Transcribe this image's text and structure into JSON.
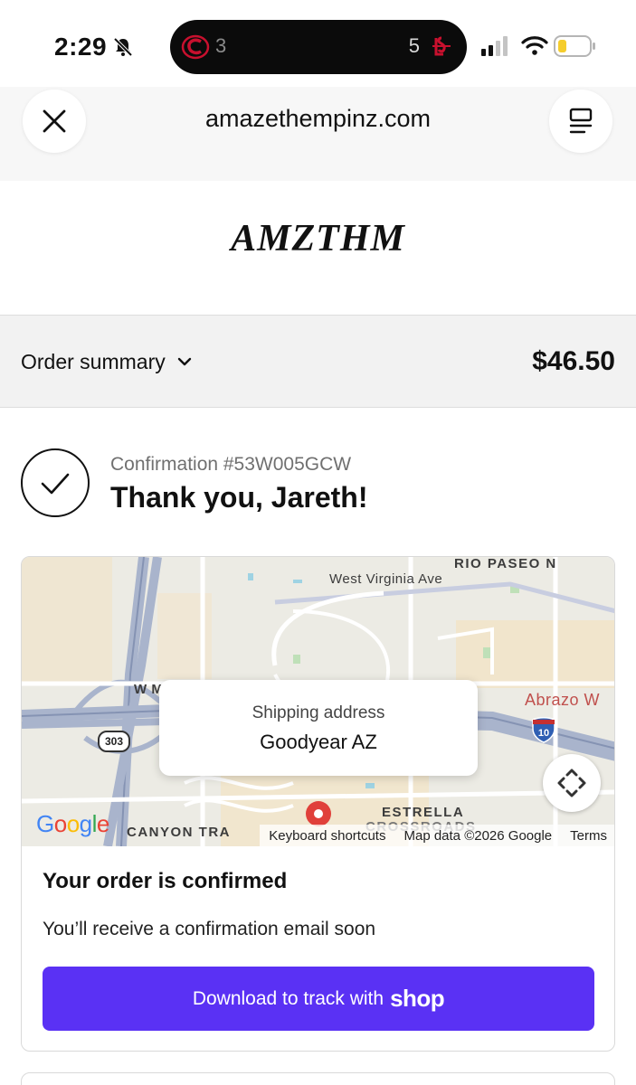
{
  "status_bar": {
    "time": "2:29",
    "live_activity": {
      "left_score": "3",
      "right_score": "5"
    }
  },
  "browser": {
    "url": "amazethempinz.com",
    "close_icon": "close-icon",
    "menu_icon": "tabs-menu-icon"
  },
  "brand": {
    "logo_text": "AMZTHM"
  },
  "order_summary": {
    "label": "Order summary",
    "total": "$46.50"
  },
  "confirmation": {
    "number": "Confirmation #53W005GCW",
    "title": "Thank you, Jareth!"
  },
  "map": {
    "shipping_label": "Shipping address",
    "shipping_value": "Goodyear AZ",
    "streets": {
      "west_virginia": "West Virginia Ave",
      "rio_paseo": "RIO PASEO N",
      "w_m": "W M",
      "abrazo": "Abrazo W",
      "estrella": "ESTRELLA",
      "crossroads": "CROSSROADS",
      "canyon": "CANYON TRA"
    },
    "highway_303": "303",
    "highway_10": "10",
    "google": "Google",
    "footer": {
      "shortcuts": "Keyboard shortcuts",
      "map_data": "Map data ©2026 Google",
      "terms": "Terms"
    }
  },
  "order_status": {
    "title": "Your order is confirmed",
    "message": "You’ll receive a confirmation email soon",
    "button_prefix": "Download to track with",
    "button_brand": "shop"
  },
  "colors": {
    "shop_purple": "#5a31f4",
    "summary_bg": "#f2f2f2",
    "map_pin": "#e0403a"
  }
}
